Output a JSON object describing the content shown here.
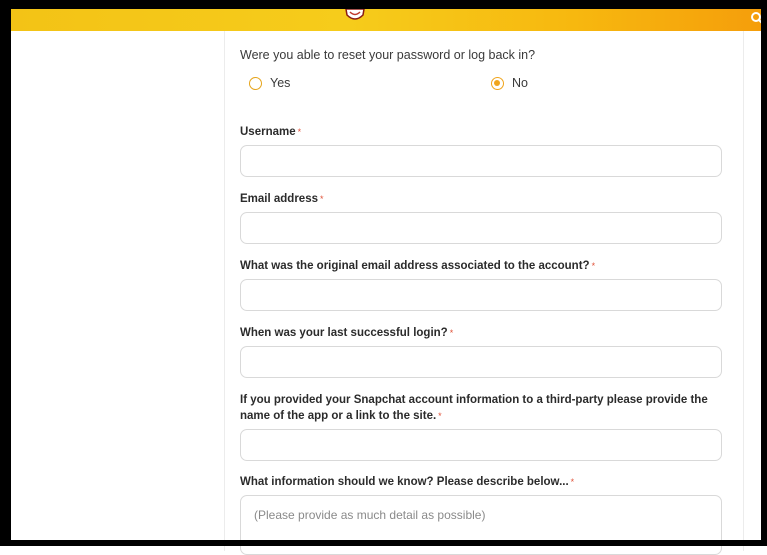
{
  "header": {
    "logo": "snapchat-ghost-logo",
    "search_icon": "search-icon",
    "colors": {
      "bar": "#f6cc1b",
      "accent": "#f0a51d"
    }
  },
  "form": {
    "question": "Were you able to reset your password or log back in?",
    "radio_yes": "Yes",
    "radio_no": "No",
    "selected": "No",
    "required_mark": "*",
    "fields": {
      "username": {
        "label": "Username",
        "value": ""
      },
      "email": {
        "label": "Email address",
        "value": ""
      },
      "original_email": {
        "label": "What was the original email address associated to the account?",
        "value": ""
      },
      "last_login": {
        "label": "When was your last successful login?",
        "value": ""
      },
      "third_party": {
        "label": "If you provided your Snapchat account information to a third-party please provide the name of the app or a link to the site.",
        "value": ""
      },
      "details": {
        "label": "What information should we know? Please describe below...",
        "placeholder": "(Please provide as much detail as possible)"
      }
    }
  }
}
